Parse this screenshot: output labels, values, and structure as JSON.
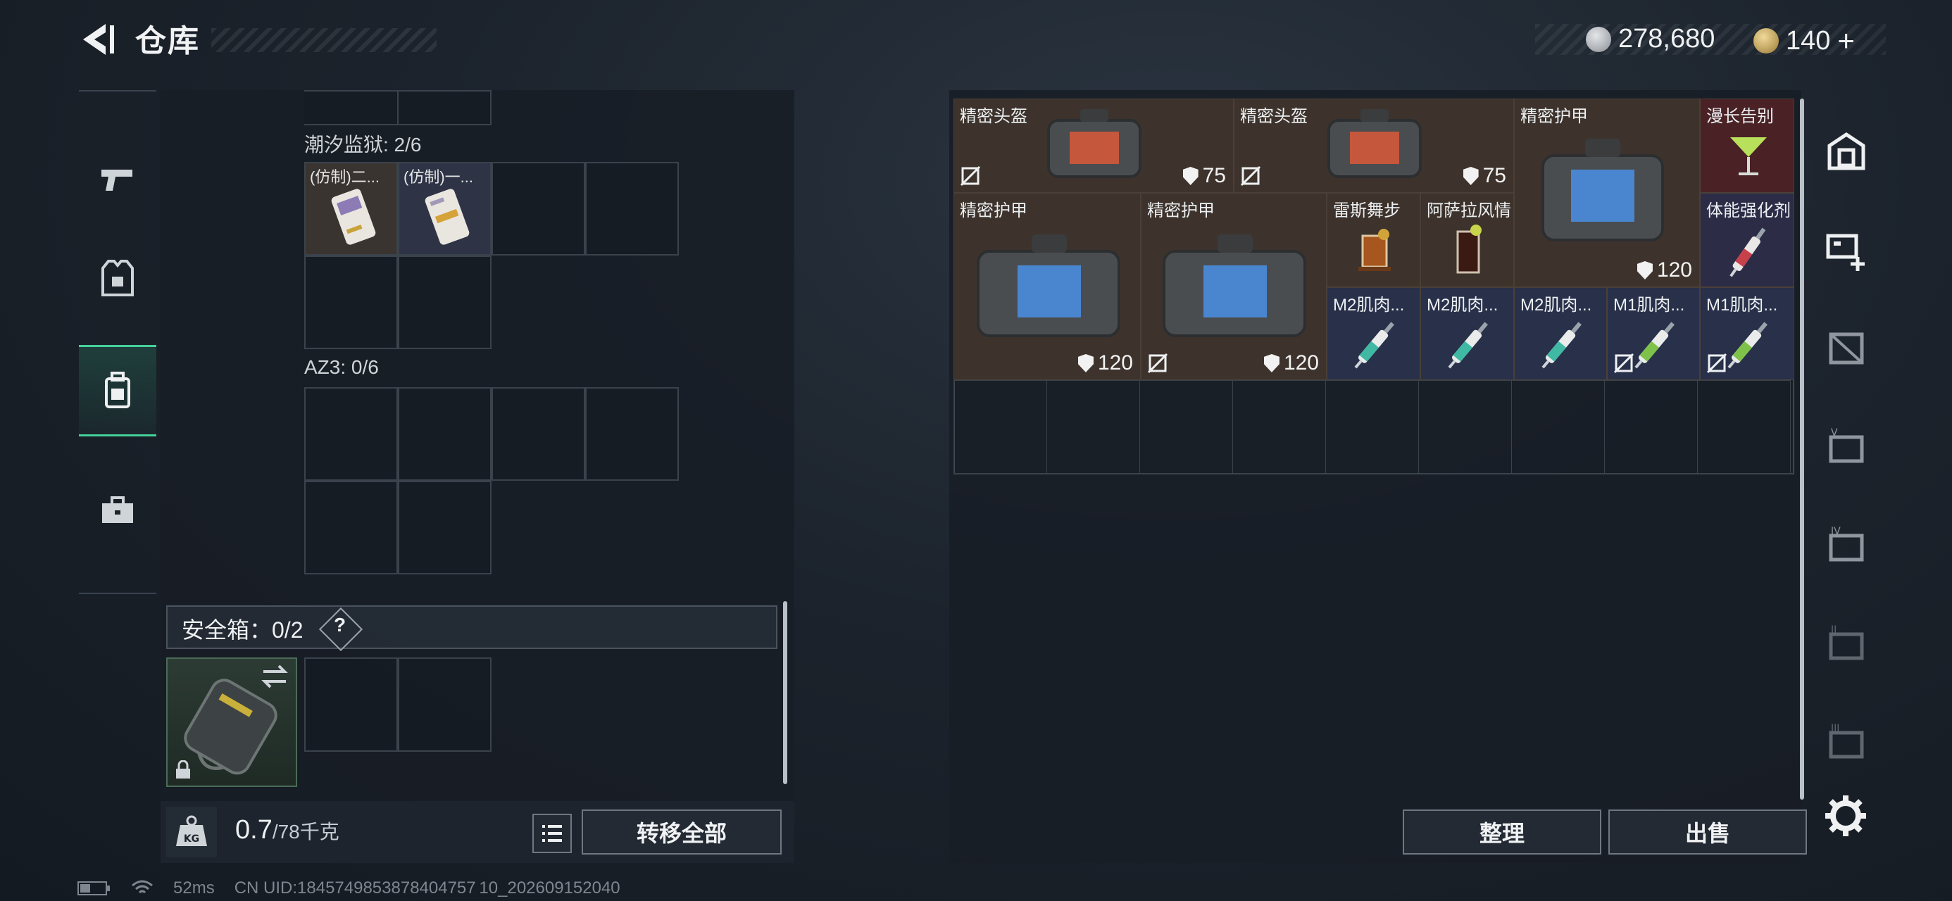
{
  "header": {
    "title": "仓库",
    "currency": {
      "coin_value": "278,680",
      "bond_value": "140",
      "bond_plus": "+"
    }
  },
  "left_nav": {
    "items": [
      {
        "name": "weapons",
        "icon": "pistol-icon"
      },
      {
        "name": "armor",
        "icon": "vest-icon"
      },
      {
        "name": "backpack",
        "icon": "backpack-icon",
        "active": true
      },
      {
        "name": "toolbox",
        "icon": "toolbox-icon"
      }
    ]
  },
  "left_panel": {
    "section1_label": "潮汐监狱: 2/6",
    "section1_items": [
      "(仿制)二...",
      "(仿制)一..."
    ],
    "section2_label": "AZ3: 0/6",
    "safebox_label": "安全箱：0/2",
    "safebox_help": "?"
  },
  "weight": {
    "current": "0.7",
    "max": "/78千克"
  },
  "buttons": {
    "transfer_all": "转移全部",
    "sort": "整理",
    "sell": "出售"
  },
  "right_panel": {
    "items": [
      {
        "name": "精密头盔",
        "durability": "75"
      },
      {
        "name": "精密头盔",
        "durability": "75"
      },
      {
        "name": "精密护甲",
        "durability": "120"
      },
      {
        "name": "漫长告别",
        "durability": ""
      },
      {
        "name": "精密护甲",
        "durability": "120"
      },
      {
        "name": "精密护甲",
        "durability": "120"
      },
      {
        "name": "雷斯舞步",
        "durability": ""
      },
      {
        "name": "阿萨拉风情",
        "durability": ""
      },
      {
        "name": "体能强化剂",
        "durability": ""
      },
      {
        "name": "M2肌肉...",
        "durability": ""
      },
      {
        "name": "M2肌肉...",
        "durability": ""
      },
      {
        "name": "M2肌肉...",
        "durability": ""
      },
      {
        "name": "M1肌肉...",
        "durability": ""
      },
      {
        "name": "M1肌肉...",
        "durability": ""
      }
    ]
  },
  "status_bar": {
    "ping": "52ms",
    "uid": "CN UID:1845749853878404757 10_202609152040"
  },
  "colors": {
    "accent": "#45d19a",
    "item_brown": "#3d332c",
    "item_red": "#4a2226",
    "item_blue": "#28304a"
  }
}
